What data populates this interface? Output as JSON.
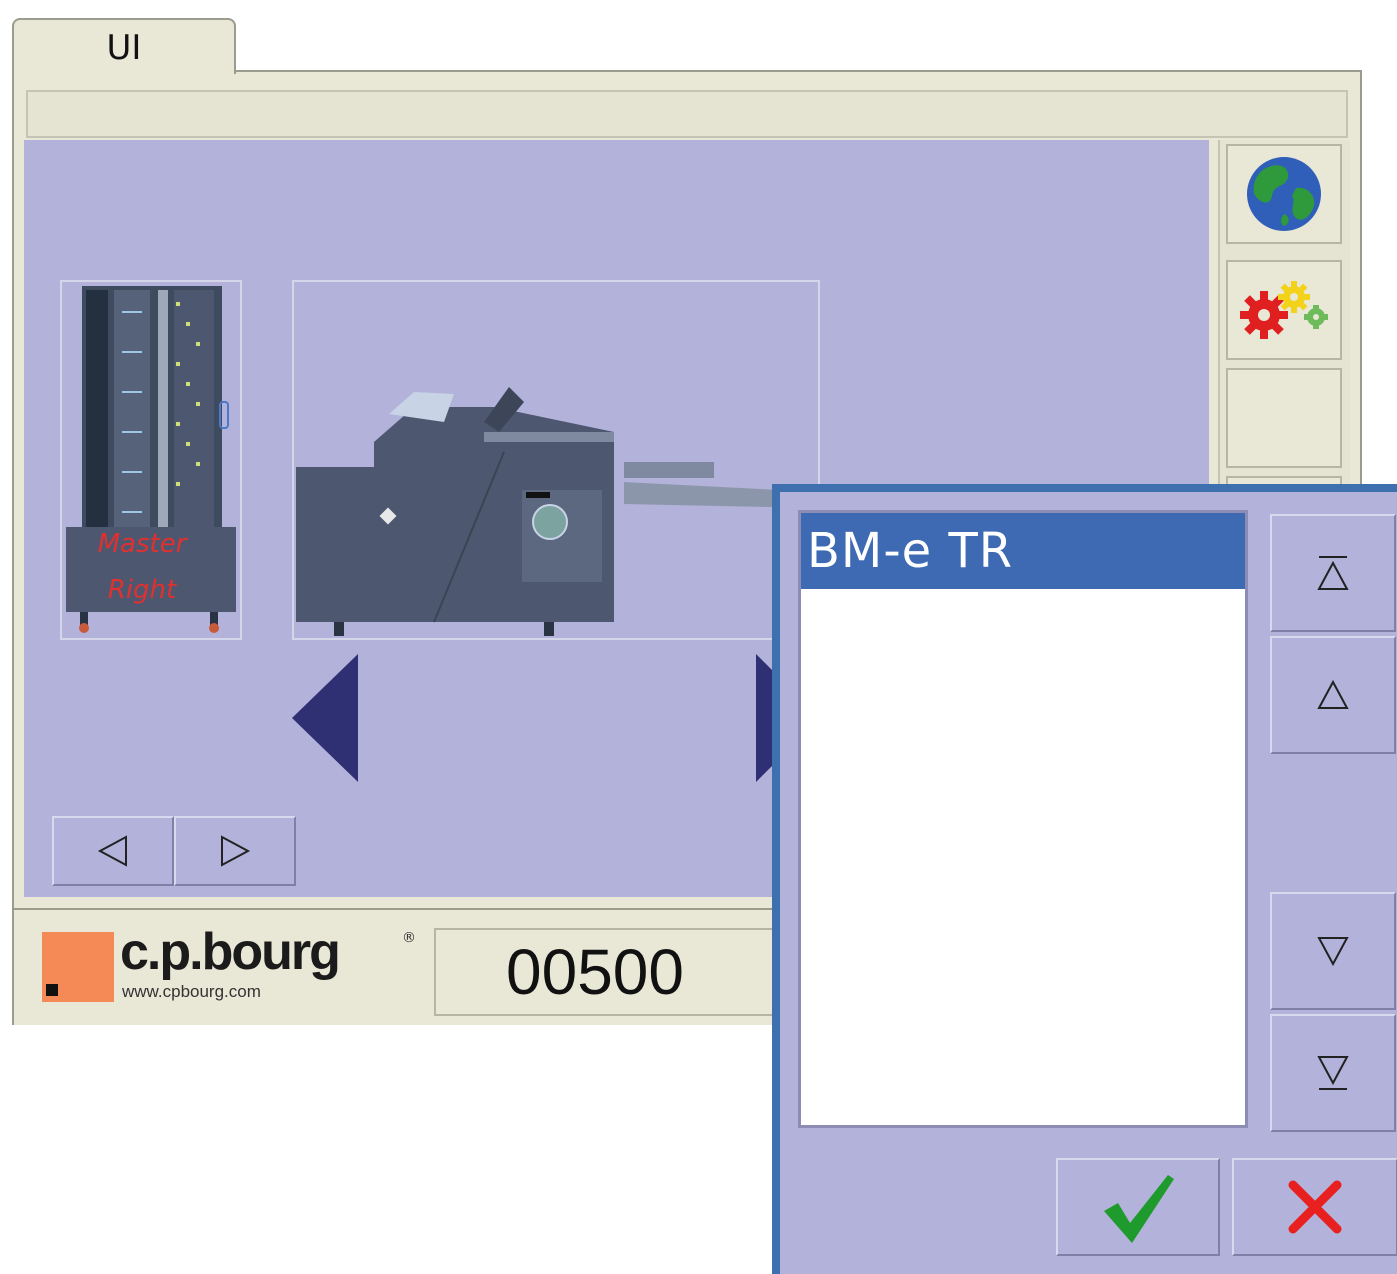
{
  "tab": {
    "label": "UI"
  },
  "machine": {
    "tower_label_line1": "Master",
    "tower_label_line2": "Right"
  },
  "status": {
    "logo_text": "c.p.bourg",
    "logo_url": "www.cpbourg.com",
    "logo_reg": "®",
    "counter": "00500"
  },
  "dialog": {
    "items": [
      "BM-e TR"
    ]
  },
  "colors": {
    "panel": "#b2b2da",
    "frame": "#e9e7d6",
    "dialog_border": "#3e6fae",
    "selection": "#3e6ab3",
    "arrow": "#2f2f73",
    "logo": "#f58a57"
  },
  "icons": {
    "language": "globe-icon",
    "settings": "gears-icon",
    "confirm": "checkmark-icon",
    "cancel": "x-icon"
  }
}
